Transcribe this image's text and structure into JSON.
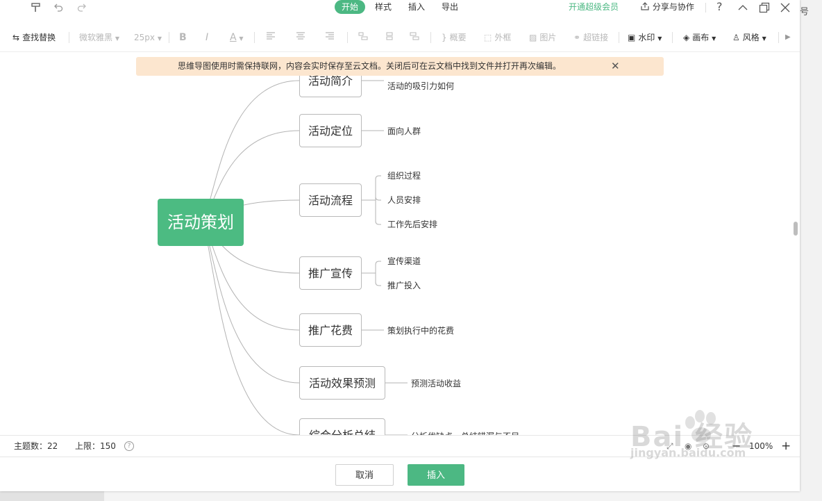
{
  "menubar": {
    "tabs": [
      {
        "label": "开始",
        "active": true
      },
      {
        "label": "样式",
        "active": false
      },
      {
        "label": "插入",
        "active": false
      },
      {
        "label": "导出",
        "active": false
      }
    ],
    "vip_label": "开通超级会员",
    "share_label": "分享与协作"
  },
  "toolbar": {
    "find_replace": "查找替换",
    "font_family": "微软雅黑",
    "font_size": "25px",
    "bold": "B",
    "italic": "I",
    "font_color": "A",
    "summary": "概要",
    "frame": "外框",
    "image": "图片",
    "hyperlink": "超链接",
    "watermark": "水印",
    "canvas": "画布",
    "style": "风格"
  },
  "notice": {
    "text": "思维导图使用时需保持联网，内容会实时保存至云文档。关闭后可在云文档中找到文件并打开再次编辑。"
  },
  "mindmap": {
    "root": "活动策划",
    "topics": [
      {
        "label": "活动简介",
        "children": [
          "活动的吸引力如何"
        ]
      },
      {
        "label": "活动定位",
        "children": [
          "面向人群"
        ]
      },
      {
        "label": "活动流程",
        "children": [
          "组织过程",
          "人员安排",
          "工作先后安排"
        ]
      },
      {
        "label": "推广宣传",
        "children": [
          "宣传渠道",
          "推广投入"
        ]
      },
      {
        "label": "推广花费",
        "children": [
          "策划执行中的花费"
        ]
      },
      {
        "label": "活动效果预测",
        "children": [
          "预测活动收益"
        ]
      },
      {
        "label": "综合分析总结",
        "children": [
          "分析优缺点，总结错漏与不足"
        ]
      }
    ]
  },
  "status": {
    "topic_count_label": "主题数：",
    "topic_count": "22",
    "limit_label": "上限：",
    "limit": "150",
    "zoom": "100%"
  },
  "footer": {
    "cancel": "取消",
    "insert": "插入"
  },
  "watermark": {
    "main": "Bai 经验",
    "sub": "jingyan.baidu.com"
  },
  "background": {
    "right_text": "号"
  },
  "colors": {
    "accent": "#4cb883",
    "root_node": "#4cbb82",
    "notice_bg": "#fce6cf"
  }
}
